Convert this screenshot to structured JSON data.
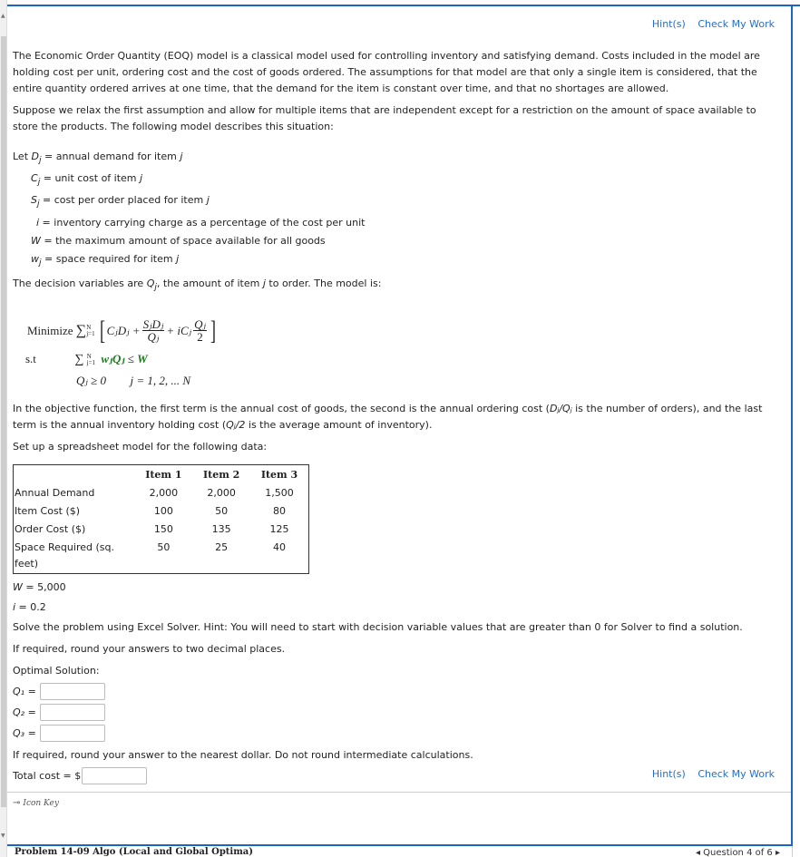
{
  "actions": {
    "hints": "Hint(s)",
    "check": "Check My Work"
  },
  "intro": {
    "p1": "The Economic Order Quantity (EOQ) model is a classical model used for controlling inventory and satisfying demand. Costs included in the model are holding cost per unit, ordering cost and the cost of goods ordered. The assumptions for that model are that only a single item is considered, that the entire quantity ordered arrives at one time, that the demand for the item is constant over time, and that no shortages are allowed.",
    "p2": "Suppose we relax the first assumption and allow for multiple items that are independent except for a restriction on the amount of space available to store the products. The following model describes this situation:"
  },
  "definitions": {
    "let": "Let",
    "items": [
      {
        "sym": "D",
        "sub": "j",
        "text": " = annual demand for item "
      },
      {
        "sym": "C",
        "sub": "j",
        "text": " = unit cost of item "
      },
      {
        "sym": "S",
        "sub": "j",
        "text": " = cost per order placed for item "
      },
      {
        "sym": "i",
        "sub": "",
        "text": " = inventory carrying charge as a percentage of the cost per unit"
      },
      {
        "sym": "W",
        "sub": "",
        "text": " = the maximum amount of space available for all goods"
      },
      {
        "sym": "w",
        "sub": "j",
        "text": " = space required for item "
      }
    ],
    "item_var": "j"
  },
  "decision": {
    "pre": "The decision variables are ",
    "var": "Q",
    "sub": "j",
    "mid": ", the amount of item ",
    "j": "j",
    "post": " to order. The model is:"
  },
  "model": {
    "minimize": "Minimize",
    "st": "s.t",
    "sum_upper": "N",
    "sum_lower": "j=1",
    "term1": "CⱼDⱼ +",
    "frac1_num": "SⱼDⱼ",
    "frac1_den": "Qⱼ",
    "plus_i": "+ iCⱼ",
    "frac2_num": "Qⱼ",
    "frac2_den": "2",
    "constraint_left": "wⱼQⱼ",
    "constraint_op": "≤",
    "constraint_right": "W",
    "nonneg": "Qⱼ ≥ 0",
    "range": "j = 1, 2, ... N"
  },
  "explain": {
    "p1a": "In the objective function, the first term is the annual cost of goods, the second is the annual ordering cost (",
    "p1b": "Dⱼ/Qⱼ",
    "p1c": " is the number of orders), and the last term is the annual inventory holding cost (",
    "p1d": "Qⱼ/2",
    "p1e": " is the average amount of inventory).",
    "p2": "Set up a spreadsheet model for the following data:"
  },
  "table": {
    "headers": [
      "",
      "Item 1",
      "Item 2",
      "Item 3"
    ],
    "rows": [
      [
        "Annual Demand",
        "2,000",
        "2,000",
        "1,500"
      ],
      [
        "Item Cost ($)",
        "100",
        "50",
        "80"
      ],
      [
        "Order Cost ($)",
        "150",
        "135",
        "125"
      ],
      [
        "Space Required (sq. feet)",
        "50",
        "25",
        "40"
      ]
    ]
  },
  "params": {
    "W_sym": "W",
    "W_val": " = 5,000",
    "i_sym": "i",
    "i_val": " = 0.2"
  },
  "instructions": {
    "solver": "Solve the problem using Excel Solver. Hint: You will need to start with decision variable values that are greater than 0 for Solver to find a solution.",
    "round2": "If required, round your answers to two decimal places.",
    "optimal": "Optimal Solution:",
    "round_dollar": "If required, round your answer to the nearest dollar. Do not round intermediate calculations."
  },
  "answers": {
    "q1_label": "Q₁ =",
    "q2_label": "Q₂ =",
    "q3_label": "Q₃ =",
    "q1_value": "",
    "q2_value": "",
    "q3_value": "",
    "total_label": "Total cost = $",
    "total_value": ""
  },
  "icon_key": "Icon Key",
  "footer": {
    "problem_title": "Problem 14-09 Algo (Local and Global Optima)",
    "question_nav": "◂ Question 4 of 6 ▸"
  }
}
